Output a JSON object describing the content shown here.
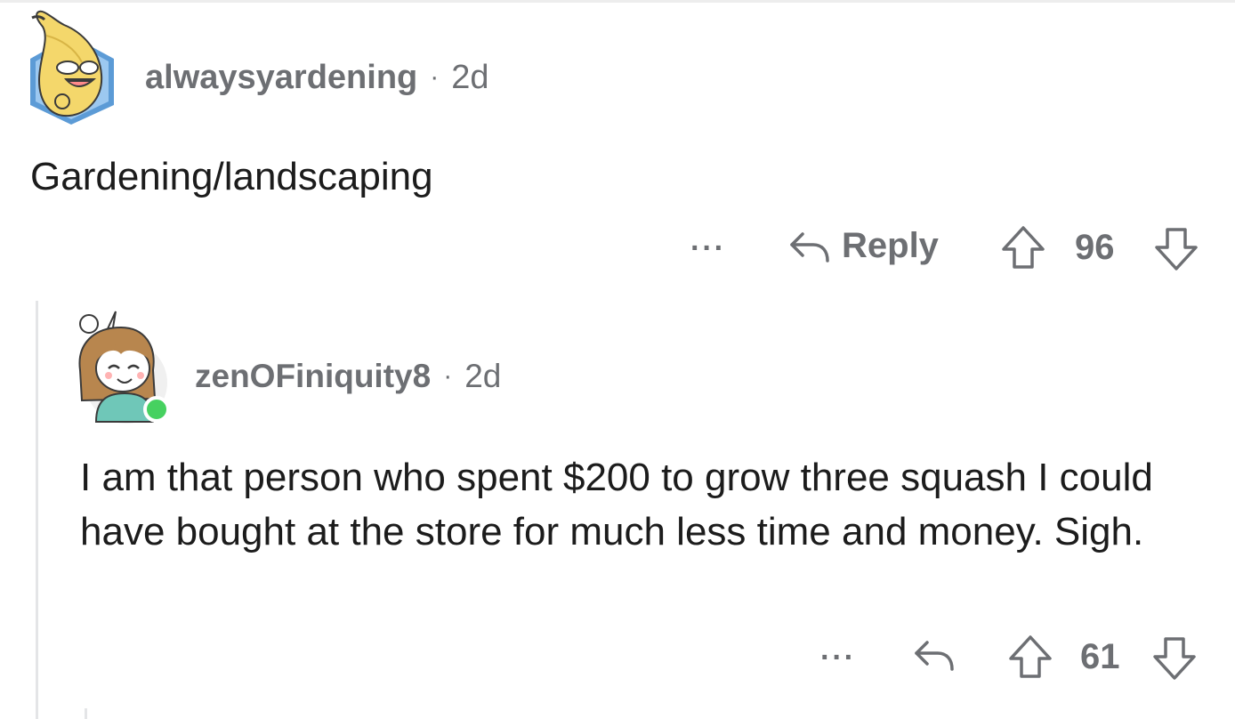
{
  "comments": [
    {
      "username": "alwaysyardening",
      "separator": "·",
      "age": "2d",
      "text": "Gardening/landscaping",
      "more_label": "···",
      "reply_label": "Reply",
      "score": "96",
      "avatar_icon": "banana-avatar-icon"
    },
    {
      "username": "zenOFiniquity8",
      "separator": "·",
      "age": "2d",
      "text": "I am that person who spent $200 to grow three squash I could have bought at the store for much less time and money. Sigh.",
      "more_label": "···",
      "score": "61",
      "online_indicator_color": "#46d160",
      "avatar_icon": "girl-avatar-icon"
    }
  ],
  "colors": {
    "meta_text": "#6d6f73",
    "body_text": "#1c1c1c",
    "thread_line": "#e4e5e7"
  }
}
